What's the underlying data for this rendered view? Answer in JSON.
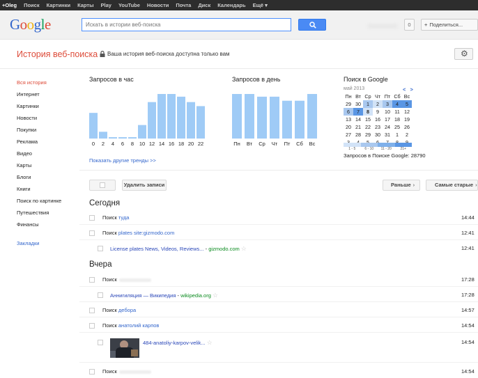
{
  "topnav": [
    "+Oleg",
    "Поиск",
    "Картинки",
    "Карты",
    "Play",
    "YouTube",
    "Новости",
    "Почта",
    "Диск",
    "Календарь",
    "Ещё ▾"
  ],
  "logo": {
    "letters": [
      "G",
      "o",
      "o",
      "g",
      "l",
      "e"
    ]
  },
  "search": {
    "placeholder": "Искать в истории веб-поиска"
  },
  "header": {
    "count": "0",
    "share_label": "Поделиться...",
    "share_plus": "+"
  },
  "page": {
    "title": "История веб-поиска",
    "privacy": "Ваша история веб-поиска доступна только вам"
  },
  "sidebar": {
    "items": [
      "Вся история",
      "Интернет",
      "Картинки",
      "Новости",
      "Покупки",
      "Реклама",
      "Видео",
      "Карты",
      "Блоги",
      "Книги",
      "Поиск по картинке",
      "Путешествия",
      "Финансы"
    ],
    "bookmarks": "Закладки"
  },
  "chart_data": [
    {
      "type": "bar",
      "title": "Запросов в час",
      "categories": [
        "0",
        "1",
        "2",
        "3",
        "4",
        "5",
        "6",
        "7",
        "8",
        "9",
        "10",
        "11",
        "12",
        "13",
        "14",
        "15",
        "16",
        "17",
        "18",
        "19",
        "20",
        "21",
        "22",
        "23"
      ],
      "tick_labels": [
        "0",
        "2",
        "4",
        "6",
        "8",
        "10",
        "12",
        "14",
        "16",
        "18",
        "20",
        "22"
      ],
      "values": [
        19,
        5,
        1,
        1,
        1,
        10,
        27,
        33,
        33,
        31,
        27,
        24
      ],
      "grid": false,
      "color": "#9fcbf6"
    },
    {
      "type": "bar",
      "title": "Запросов в день",
      "categories": [
        "Пн",
        "Вт",
        "Ср",
        "Чт",
        "Пт",
        "Сб",
        "Вс"
      ],
      "values": [
        33,
        33,
        31,
        31,
        28,
        28,
        33
      ],
      "grid": false,
      "color": "#9fcbf6"
    }
  ],
  "calendar": {
    "title": "Поиск в Google",
    "month": "май 2013",
    "nav": "< >",
    "weekdays": [
      "Пн",
      "Вт",
      "Ср",
      "Чт",
      "Пт",
      "Сб",
      "Вс"
    ],
    "weeks": [
      [
        "29",
        "30",
        "1",
        "2",
        "3",
        "4",
        "5"
      ],
      [
        "6",
        "7",
        "8",
        "9",
        "10",
        "11",
        "12"
      ],
      [
        "13",
        "14",
        "15",
        "16",
        "17",
        "18",
        "19"
      ],
      [
        "20",
        "21",
        "22",
        "23",
        "24",
        "25",
        "26"
      ],
      [
        "27",
        "28",
        "29",
        "30",
        "31",
        "1",
        "2"
      ],
      [
        "3",
        "4",
        "5",
        "6",
        "7",
        "8",
        "9"
      ]
    ],
    "levels": [
      [
        0,
        0,
        2,
        1,
        2,
        3,
        3
      ],
      [
        2,
        3,
        1,
        0,
        0,
        0,
        0
      ],
      [
        0,
        0,
        0,
        0,
        0,
        0,
        0
      ],
      [
        0,
        0,
        0,
        0,
        0,
        0,
        0
      ],
      [
        0,
        0,
        0,
        0,
        0,
        0,
        0
      ],
      [
        0,
        0,
        0,
        0,
        0,
        0,
        0
      ]
    ],
    "level_colors": [
      "#ffffff",
      "#d2e3f7",
      "#a9c8ef",
      "#5a96e4"
    ],
    "legend": {
      "labels": [
        "1 - 5",
        "6 - 10",
        "11 - 20",
        "21+"
      ],
      "colors": [
        "#d2e3f7",
        "#a9c8ef",
        "#7fb0ea",
        "#5a96e4"
      ]
    },
    "total": "Запросов в Поиске Google: 28790"
  },
  "trends_link": "Показать другие тренды >>",
  "toolbar": {
    "delete": "Удалить записи",
    "newer": "Раньше",
    "older": "Самые старые",
    "arrow": "›"
  },
  "history": {
    "today": "Сегодня",
    "yesterday": "Вчера",
    "search_prefix": "Поиск",
    "rows": [
      {
        "query": "туда",
        "time": "14:44"
      },
      {
        "query": "plates site:gizmodo.com",
        "time": "12:41"
      },
      {
        "link": "License plates News, Videos, Reviews...",
        "domain": "gizmodo.com",
        "sep": " - ",
        "time": "12:41"
      },
      {
        "query": "",
        "time": "17:28"
      },
      {
        "link": "Аннигиляция — Википедия",
        "domain": "wikipedia.org",
        "sep": " - ",
        "time": "17:28"
      },
      {
        "query": "дебора",
        "time": "14:57"
      },
      {
        "query": "анатолий карпов",
        "time": "14:54"
      },
      {
        "link": "484-anatoliy-karpov-velik...",
        "time": "14:54"
      },
      {
        "query": "",
        "time": "14:54"
      }
    ]
  }
}
